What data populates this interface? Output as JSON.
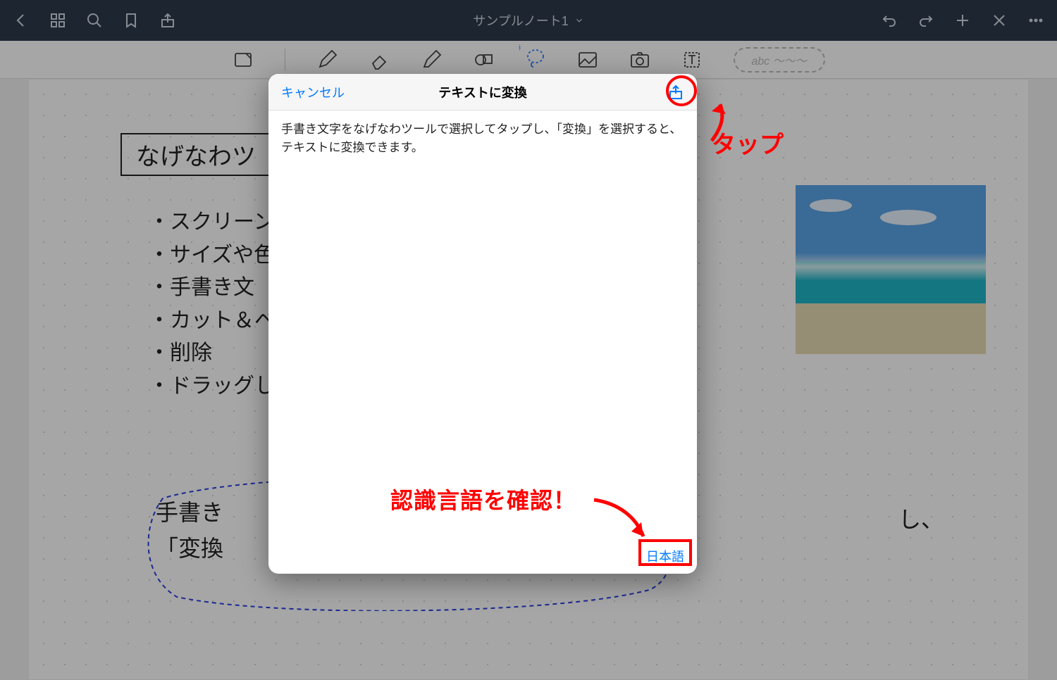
{
  "titlebar": {
    "title": "サンプルノート1"
  },
  "toolbar": {
    "placeholder_text": "abc ～～～"
  },
  "page": {
    "hw_title": "なげなわツ",
    "list": [
      "スクリーン",
      "サイズや色",
      "手書き文",
      "カット＆ペ",
      "削除",
      "ドラッグし"
    ],
    "bottom_line1": "手書き",
    "bottom_line2": "「変換",
    "bottom_right_fragment": "し、"
  },
  "modal": {
    "cancel": "キャンセル",
    "title": "テキストに変換",
    "body": "手書き文字をなげなわツールで選択してタップし、「変換」を選択すると、テキストに変換できます。",
    "language": "日本語"
  },
  "annotations": {
    "tap": "タップ",
    "confirm_lang": "認識言語を確認！"
  }
}
